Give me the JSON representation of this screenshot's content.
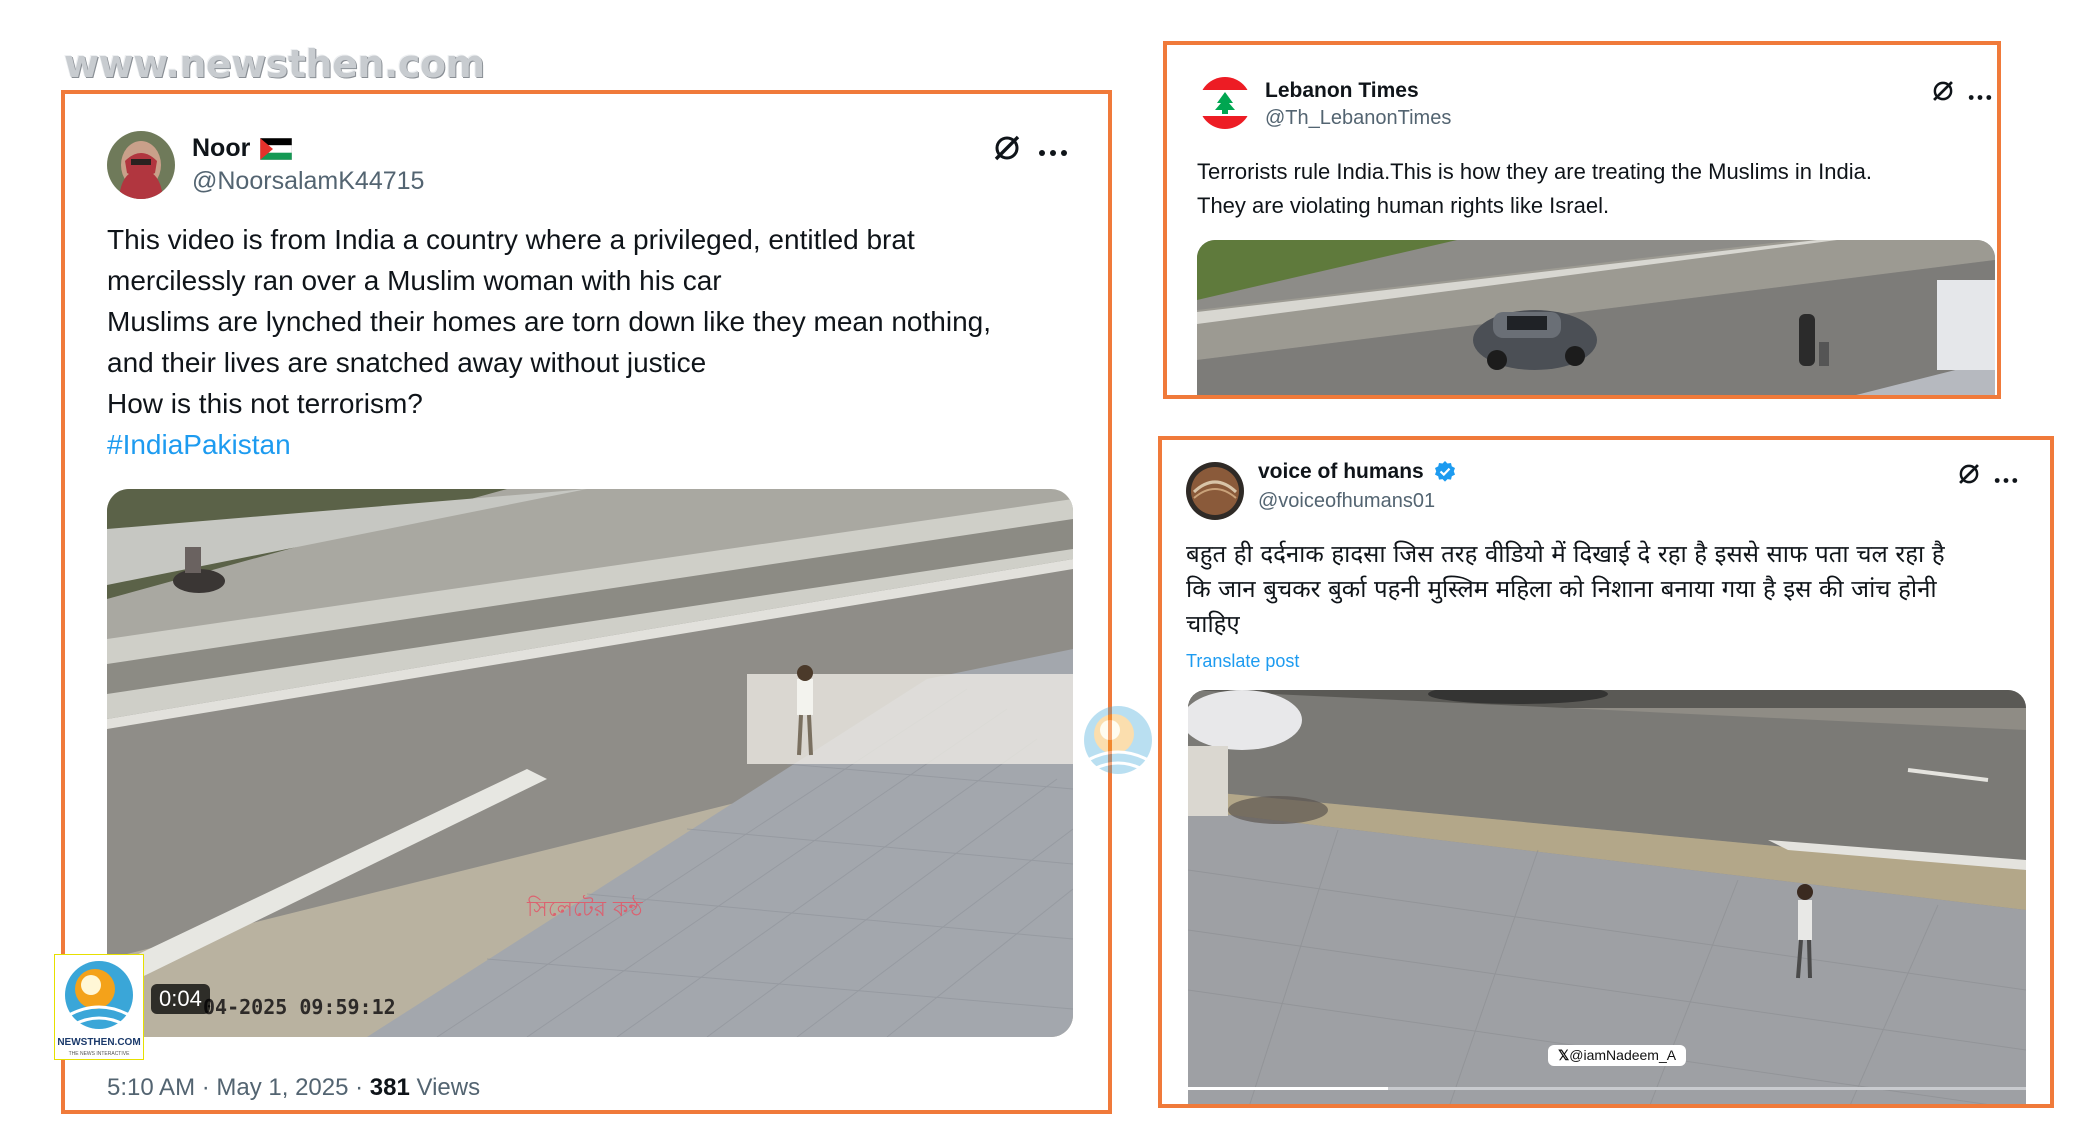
{
  "watermark": {
    "url": "www.newsthen.com",
    "logo_text": "NEWSTHEN.COM",
    "logo_tagline": "THE NEWS INTERACTIVE"
  },
  "posts": [
    {
      "name": "Noor",
      "handle": "@NoorsalamK44715",
      "lines": [
        "This video is from India a country where a privileged, entitled brat",
        "mercilessly ran over a Muslim woman with his car",
        "Muslims are lynched their homes are torn down like they mean nothing,",
        "and their lives are snatched away without justice",
        "How is this not terrorism?"
      ],
      "hashtag": "#IndiaPakistan",
      "video_timestamp": "04-2025 09:59:12",
      "video_overlay_text": "সিলেটের কন্ঠ",
      "duration": "0:04",
      "time": "5:10 AM · May 1, 2025 · ",
      "views_count": "381",
      "views_label": " Views",
      "icons": [
        "grok-icon",
        "more-icon",
        "palestine-flag-icon"
      ]
    },
    {
      "name": "Lebanon Times",
      "handle": "@Th_LebanonTimes",
      "lines": [
        "Terrorists rule India.This is how they are treating the Muslims in India.",
        "They are violating human rights like Israel."
      ],
      "icons": [
        "lebanon-flag-avatar",
        "grok-icon",
        "more-icon"
      ]
    },
    {
      "name": "voice of humans",
      "handle": "@voiceofhumans01",
      "lines": [
        "बहुत ही दर्दनाक हादसा जिस तरह वीडियो में दिखाई दे रहा है इससे साफ पता चल रहा है",
        "कि जान बुचकर बुर्का पहनी मुस्लिम महिला को निशाना बनाया गया है इस की जांच होनी",
        "चाहिए"
      ],
      "translate": "Translate post",
      "video_credit": "@iamNadeem_A",
      "icons": [
        "verified-icon",
        "grok-icon",
        "more-icon"
      ]
    }
  ],
  "colors": {
    "frame": "#f07a3a",
    "link": "#1d9bf0",
    "secondary": "#536471",
    "verified": "#1d9bf0"
  }
}
